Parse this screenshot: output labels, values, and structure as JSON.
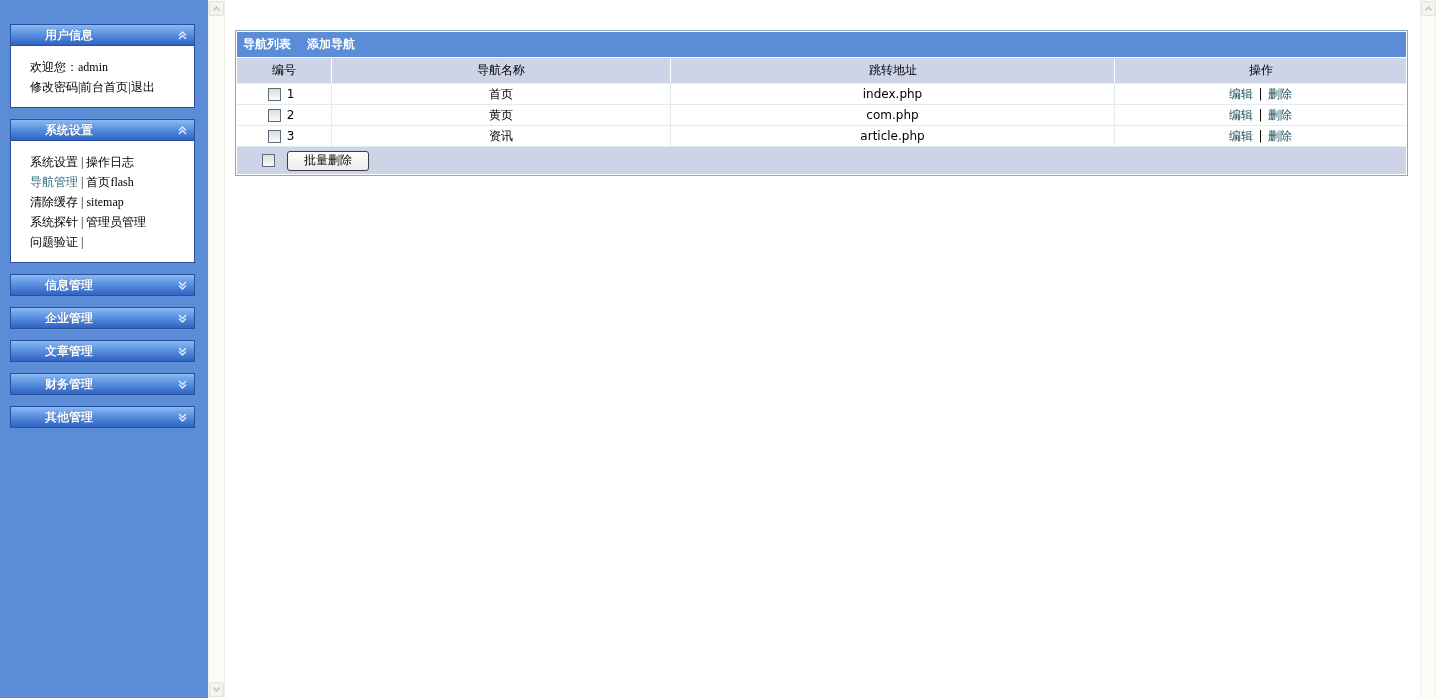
{
  "sidebar": {
    "panels": [
      {
        "title": "用户信息",
        "kind": "user",
        "expanded": true,
        "lines": [
          {
            "items": [
              {
                "kind": "text",
                "text": "欢迎您：admin"
              }
            ]
          },
          {
            "items": [
              {
                "kind": "link",
                "label": "修改密码",
                "selected": false
              },
              {
                "kind": "separator",
                "text": "|"
              },
              {
                "kind": "link",
                "label": "前台首页",
                "selected": false
              },
              {
                "kind": "separator",
                "text": "|"
              },
              {
                "kind": "link",
                "label": "退出",
                "selected": false
              }
            ]
          }
        ]
      },
      {
        "title": "系统设置",
        "kind": "menu",
        "expanded": true,
        "lines": [
          {
            "items": [
              {
                "kind": "link",
                "label": "系统设置",
                "selected": false
              },
              {
                "kind": "separator",
                "text": "|"
              },
              {
                "kind": "link",
                "label": "操作日志",
                "selected": false
              }
            ]
          },
          {
            "items": [
              {
                "kind": "link",
                "label": "导航管理",
                "selected": true
              },
              {
                "kind": "separator",
                "text": "|"
              },
              {
                "kind": "link",
                "label": "首页flash",
                "selected": false
              }
            ]
          },
          {
            "items": [
              {
                "kind": "link",
                "label": "清除缓存",
                "selected": false
              },
              {
                "kind": "separator",
                "text": "|"
              },
              {
                "kind": "link",
                "label": "sitemap",
                "selected": false
              }
            ]
          },
          {
            "items": [
              {
                "kind": "link",
                "label": "系统探针",
                "selected": false
              },
              {
                "kind": "separator",
                "text": "|"
              },
              {
                "kind": "link",
                "label": "管理员管理",
                "selected": false
              }
            ]
          },
          {
            "items": [
              {
                "kind": "link",
                "label": "问题验证",
                "selected": false
              },
              {
                "kind": "separator",
                "text": "|"
              }
            ]
          }
        ]
      },
      {
        "title": "信息管理",
        "kind": "menu",
        "expanded": false
      },
      {
        "title": "企业管理",
        "kind": "menu",
        "expanded": false
      },
      {
        "title": "文章管理",
        "kind": "menu",
        "expanded": false
      },
      {
        "title": "财务管理",
        "kind": "menu",
        "expanded": false
      },
      {
        "title": "其他管理",
        "kind": "menu",
        "expanded": false
      }
    ]
  },
  "table": {
    "title_links": [
      {
        "label": "导航列表"
      },
      {
        "label": "添加导航"
      }
    ],
    "columns": [
      "编号",
      "导航名称",
      "跳转地址",
      "操作"
    ],
    "rows": [
      {
        "number": "1",
        "checked": false,
        "name": "首页",
        "url": "index.php",
        "actions": [
          {
            "kind": "link",
            "label": "编辑"
          },
          {
            "kind": "separator",
            "text": "|"
          },
          {
            "kind": "link",
            "label": "删除"
          }
        ]
      },
      {
        "number": "2",
        "checked": false,
        "name": "黄页",
        "url": "com.php",
        "actions": [
          {
            "kind": "link",
            "label": "编辑"
          },
          {
            "kind": "separator",
            "text": "|"
          },
          {
            "kind": "link",
            "label": "删除"
          }
        ]
      },
      {
        "number": "3",
        "checked": false,
        "name": "资讯",
        "url": "article.php",
        "actions": [
          {
            "kind": "link",
            "label": "编辑"
          },
          {
            "kind": "separator",
            "text": "|"
          },
          {
            "kind": "link",
            "label": "删除"
          }
        ]
      }
    ],
    "footer": {
      "select_all": {
        "checked": false
      },
      "button": "批量删除"
    }
  }
}
